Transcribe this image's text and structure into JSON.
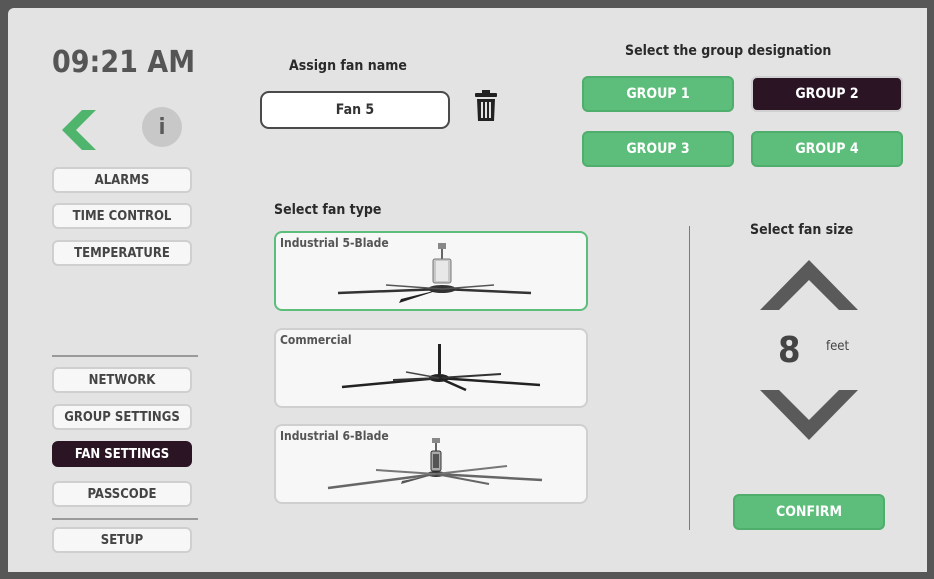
{
  "clock": {
    "time": "09:21 AM"
  },
  "nav": {
    "info_label": "i",
    "top_items": [
      {
        "label": "ALARMS",
        "active": false
      },
      {
        "label": "TIME CONTROL",
        "active": false
      },
      {
        "label": "TEMPERATURE",
        "active": false
      }
    ],
    "bottom_items": [
      {
        "label": "NETWORK",
        "active": false
      },
      {
        "label": "GROUP SETTINGS",
        "active": false
      },
      {
        "label": "FAN SETTINGS",
        "active": true
      },
      {
        "label": "PASSCODE",
        "active": false
      }
    ],
    "setup_label": "SETUP"
  },
  "fan_name": {
    "heading": "Assign fan name",
    "value": "Fan 5",
    "delete_icon": "trash-icon"
  },
  "group": {
    "heading": "Select the group designation",
    "options": [
      {
        "label": "GROUP 1",
        "selected": false
      },
      {
        "label": "GROUP 2",
        "selected": true
      },
      {
        "label": "GROUP 3",
        "selected": false
      },
      {
        "label": "GROUP 4",
        "selected": false
      }
    ]
  },
  "fan_type": {
    "heading": "Select fan type",
    "options": [
      {
        "label": "Industrial 5-Blade",
        "selected": true
      },
      {
        "label": "Commercial",
        "selected": false
      },
      {
        "label": "Industrial 6-Blade",
        "selected": false
      }
    ]
  },
  "fan_size": {
    "heading": "Select fan size",
    "value": "8",
    "unit": "feet",
    "up_icon": "chevron-up-icon",
    "down_icon": "chevron-down-icon"
  },
  "confirm_label": "CONFIRM",
  "colors": {
    "accent_green": "#5cbe7a",
    "active_dark": "#2b1525",
    "background": "#e3e3e3",
    "frame": "#575757"
  }
}
